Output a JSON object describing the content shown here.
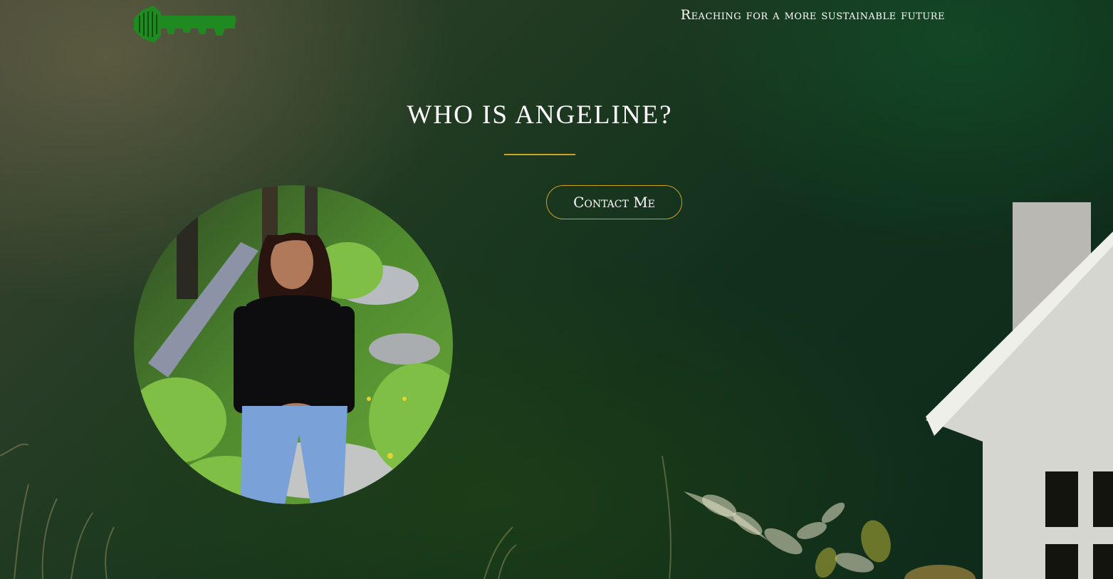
{
  "header": {
    "logo_name": "company-logo",
    "tagline": "Reaching for a more sustainable future"
  },
  "hero": {
    "title": "WHO IS ANGELINE?",
    "contact_button_label": "Contact Me"
  },
  "colors": {
    "accent_gold": "#c9a227",
    "logo_green": "#1f8a1f",
    "text_white": "#ffffff"
  }
}
